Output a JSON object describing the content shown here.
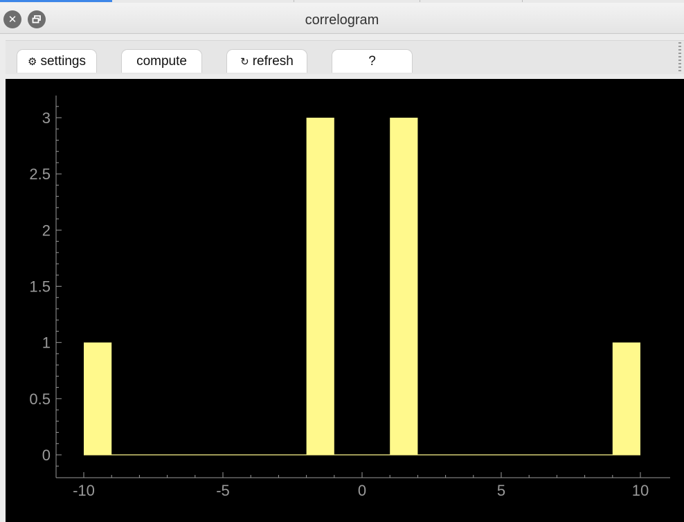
{
  "window": {
    "title": "correlogram"
  },
  "toolbar": {
    "settings_label": "settings",
    "settings_icon": "gear-icon",
    "compute_label": "compute",
    "refresh_label": "refresh",
    "refresh_icon": "refresh-icon",
    "help_label": "?"
  },
  "colors": {
    "bar": "#fff98c",
    "axis": "#9a9a9a",
    "plot_bg": "#000000"
  },
  "chart_data": {
    "type": "bar",
    "x": [
      -9.5,
      -1.5,
      1.5,
      9.5
    ],
    "values": [
      1,
      3,
      3,
      1
    ],
    "bin_width": 1,
    "xlim": [
      -11,
      11
    ],
    "ylim": [
      -0.2,
      3.2
    ],
    "x_ticks": [
      -10,
      -5,
      0,
      5,
      10
    ],
    "x_tick_labels": [
      "-10",
      "-5",
      "0",
      "5",
      "10"
    ],
    "y_ticks": [
      0,
      0.5,
      1,
      1.5,
      2,
      2.5,
      3
    ],
    "y_tick_labels": [
      "0",
      "0.5",
      "1",
      "1.5",
      "2",
      "2.5",
      "3"
    ],
    "baseline": {
      "from": -10,
      "to": 10,
      "value": 0
    },
    "title": "",
    "xlabel": "",
    "ylabel": "",
    "grid": false
  }
}
